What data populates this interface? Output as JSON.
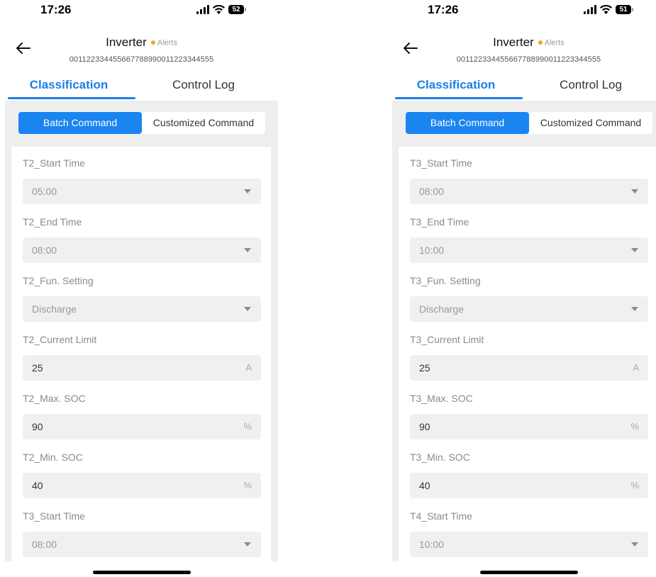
{
  "screens": [
    {
      "status": {
        "time": "17:26",
        "battery": "52"
      },
      "header": {
        "title": "Inverter",
        "alerts_label": "Alerts",
        "serial": "001122334455667788990011223344555"
      },
      "tabs": [
        "Classification",
        "Control Log"
      ],
      "segments": [
        "Batch Command",
        "Customized Command"
      ],
      "fields": [
        {
          "label": "T2_Start Time",
          "value": "05:00",
          "kind": "dropdown"
        },
        {
          "label": "T2_End Time",
          "value": "08:00",
          "kind": "dropdown"
        },
        {
          "label": "T2_Fun. Setting",
          "value": "Discharge",
          "kind": "dropdown"
        },
        {
          "label": "T2_Current Limit",
          "value": "25",
          "unit": "A",
          "kind": "input"
        },
        {
          "label": "T2_Max. SOC",
          "value": "90",
          "unit": "%",
          "kind": "input"
        },
        {
          "label": "T2_Min. SOC",
          "value": "40",
          "unit": "%",
          "kind": "input"
        },
        {
          "label": "T3_Start Time",
          "value": "08:00",
          "kind": "dropdown"
        }
      ]
    },
    {
      "status": {
        "time": "17:26",
        "battery": "51"
      },
      "header": {
        "title": "Inverter",
        "alerts_label": "Alerts",
        "serial": "001122334455667788990011223344555"
      },
      "tabs": [
        "Classification",
        "Control Log"
      ],
      "segments": [
        "Batch Command",
        "Customized Command"
      ],
      "fields": [
        {
          "label": "T3_Start Time",
          "value": "08:00",
          "kind": "dropdown"
        },
        {
          "label": "T3_End Time",
          "value": "10:00",
          "kind": "dropdown"
        },
        {
          "label": "T3_Fun. Setting",
          "value": "Discharge",
          "kind": "dropdown"
        },
        {
          "label": "T3_Current Limit",
          "value": "25",
          "unit": "A",
          "kind": "input"
        },
        {
          "label": "T3_Max. SOC",
          "value": "90",
          "unit": "%",
          "kind": "input"
        },
        {
          "label": "T3_Min. SOC",
          "value": "40",
          "unit": "%",
          "kind": "input"
        },
        {
          "label": "T4_Start Time",
          "value": "10:00",
          "kind": "dropdown"
        }
      ]
    }
  ],
  "colors": {
    "accent": "#1a7fe6",
    "alert_dot": "#f5a623",
    "panel_bg": "#eeeeee",
    "field_bg": "#f0f0f0"
  },
  "icons": [
    "back-arrow-icon",
    "signal-icon",
    "wifi-icon",
    "battery-icon",
    "dropdown-caret-icon"
  ]
}
